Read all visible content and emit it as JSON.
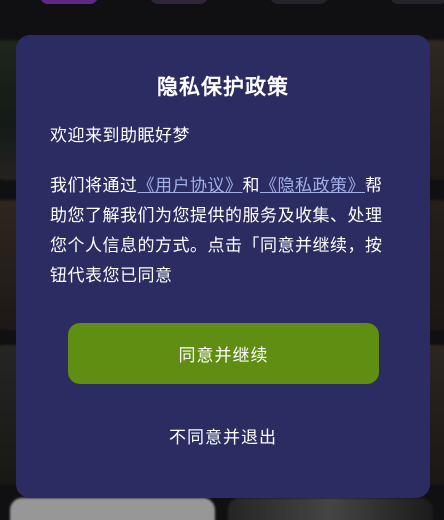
{
  "dialog": {
    "title": "隐私保护政策",
    "greeting": "欢迎来到助眠好梦",
    "body_prefix": "我们将通过",
    "user_agreement_link": "《用户协议》",
    "conjunction": "和",
    "privacy_policy_link": "《隐私政策》",
    "body_suffix": "帮助您了解我们为您提供的服务及收集、处理您个人信息的方式。点击「同意并继续，按钮代表您已同意",
    "agree_label": "同意并继续",
    "disagree_label": "不同意并退出"
  },
  "colors": {
    "dialog_bg": "#2b2d62",
    "agree_button_bg": "#5f8e12",
    "link": "#9fb0e8"
  }
}
